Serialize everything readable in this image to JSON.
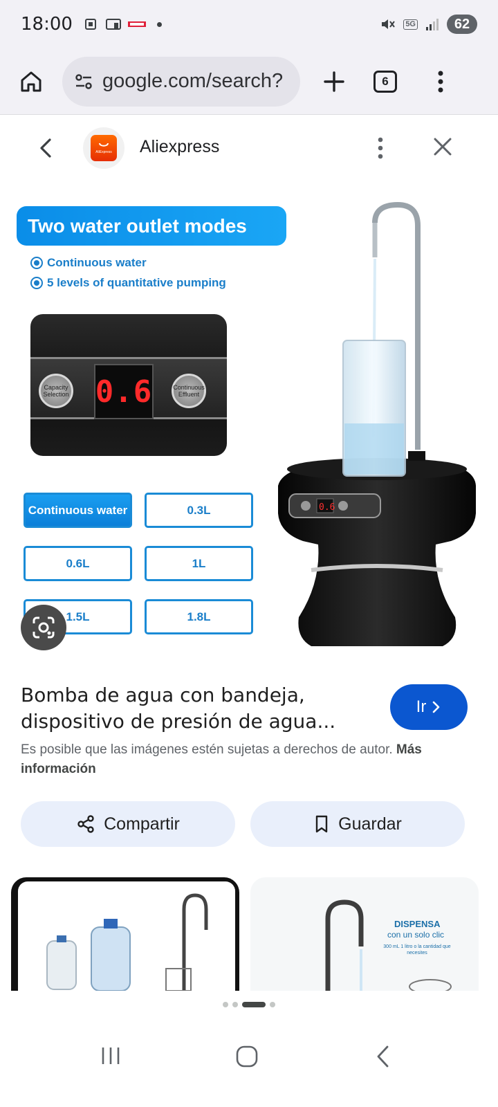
{
  "status_bar": {
    "time": "18:00",
    "battery": "62",
    "network": "5G"
  },
  "browser": {
    "url": "google.com/search?",
    "tab_count": "6"
  },
  "viewer": {
    "source_name": "Aliexpress",
    "source_logo_text": "AliExpress"
  },
  "product_image": {
    "headline": "Two water outlet modes",
    "modes": [
      "Continuous water",
      "5 levels of quantitative pumping"
    ],
    "panel": {
      "left_button": "Capacity Selection",
      "display": "0.6",
      "right_button": "Continuous Effluent"
    },
    "options": [
      "Continuous water",
      "0.3L",
      "0.6L",
      "1L",
      "1.5L",
      "1.8L"
    ],
    "selected_option": "Continuous water"
  },
  "result": {
    "title": "Bomba de agua con bandeja, dispositivo de presión de agua...",
    "go_label": "Ir",
    "copyright_text": "Es posible que las imágenes estén sujetas a derechos de autor.",
    "more_info_label": "Más información",
    "share_label": "Compartir",
    "save_label": "Guardar"
  },
  "related": {
    "right_caption_title": "DISPENSA",
    "right_caption_sub": "con un solo clic",
    "right_caption_detail": "300 mL 1 litro o la cantidad que necesites"
  },
  "pagination": {
    "count": 4,
    "active_index": 2
  },
  "colors": {
    "accent": "#0b57d0",
    "chip": "#e9effb",
    "aliexpress": "#e62e04",
    "image_blue": "#1a8bd6"
  },
  "icons": [
    "home-icon",
    "site-settings-icon",
    "new-tab-icon",
    "tab-switcher-icon",
    "more-vert-icon",
    "back-icon",
    "close-icon",
    "google-lens-icon",
    "share-icon",
    "bookmark-icon",
    "chevron-right-icon"
  ]
}
